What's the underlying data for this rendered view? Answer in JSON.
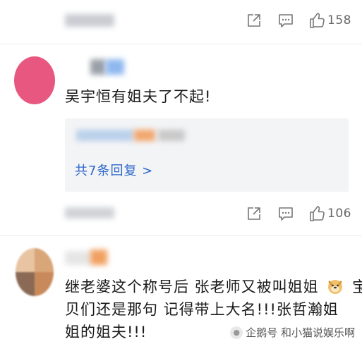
{
  "comments": [
    {
      "share_label": "分享",
      "reply_label": "回复",
      "likes": "158"
    },
    {
      "text": "吴宇恒有姐夫了不起!",
      "replies_link": "共7条回复 >",
      "share_label": "分享",
      "reply_label": "回复",
      "likes": "106",
      "avatar_color": "#e8577f"
    },
    {
      "text_line1": "继老婆这个称号后 张老师又被叫姐姐",
      "text_line1b": "宝",
      "text_line2": "贝们还是那句 记得带上大名!!!张哲瀚姐",
      "text_line3": "姐的姐夫!!!",
      "emoji": "doge-emoji"
    }
  ],
  "watermark": {
    "text": "企鹅号 和小猫说娱乐啊"
  },
  "colors": {
    "link": "#2f68c9",
    "icon": "#777777",
    "reply_bg": "#f3f4f6"
  }
}
